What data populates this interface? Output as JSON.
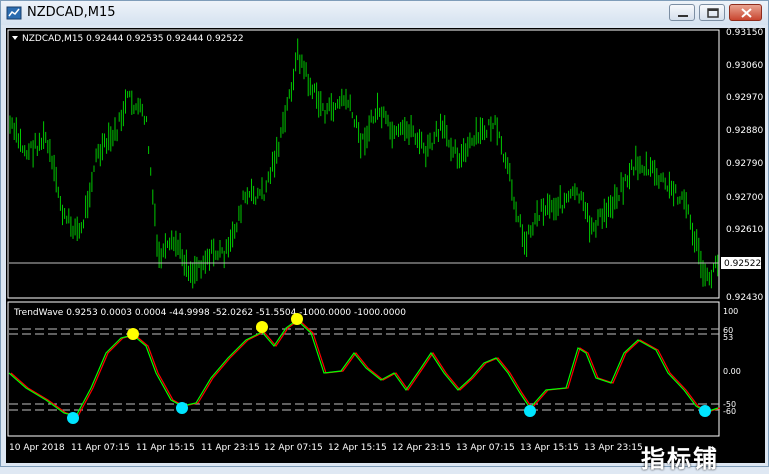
{
  "window": {
    "title": "NZDCAD,M15"
  },
  "main_chart": {
    "label": "NZDCAD,M15  0.92444 0.92535 0.92444 0.92522",
    "current_price": "0.92522",
    "y_ticks": [
      "0.93150",
      "0.93060",
      "0.92970",
      "0.92880",
      "0.92790",
      "0.92700",
      "0.92610",
      "0.92522",
      "0.92430"
    ],
    "colors": {
      "candles": "#00c800",
      "background": "#000000",
      "price_line": "#c0c0c0"
    }
  },
  "indicator": {
    "label": "TrendWave 0.9253 0.0003 0.0004 -44.9998 -52.0262 -51.5504 -1000.0000 -1000.0000",
    "y_ticks": [
      "100",
      "60",
      "53",
      "0.00",
      "-50",
      "-60"
    ],
    "colors": {
      "fast": "#00ff00",
      "slow": "#ff0000",
      "top_signal": "#ffff00",
      "bottom_signal": "#00e5ff"
    }
  },
  "time_axis": {
    "labels": [
      "10 Apr 2018",
      "11 Apr 07:15",
      "11 Apr 15:15",
      "11 Apr 23:15",
      "12 Apr 07:15",
      "12 Apr 15:15",
      "12 Apr 23:15",
      "13 Apr 07:15",
      "13 Apr 15:15",
      "13 Apr 23:15"
    ]
  },
  "watermark": "指标铺"
}
